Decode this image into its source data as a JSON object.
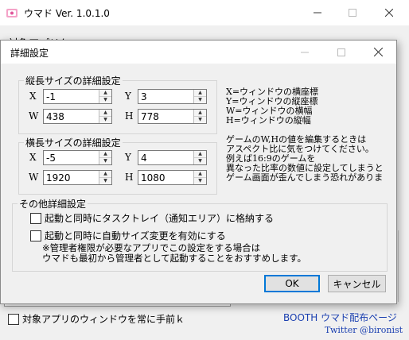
{
  "main_window": {
    "title": "ウマド Ver. 1.0.1.0",
    "partial_label": "対象アプリケ",
    "topmost_checkbox_label": "対象アプリのウィンドウを常に手前ｋ",
    "topmost_checked": false,
    "booth_link": "BOOTH ウマド配布ページ",
    "twitter": "Twitter @bironist"
  },
  "dialog": {
    "title": "詳細設定",
    "portrait": {
      "title": "縦長サイズの詳細設定",
      "x_label": "X",
      "x_value": "-1",
      "y_label": "Y",
      "y_value": "3",
      "w_label": "W",
      "w_value": "438",
      "h_label": "H",
      "h_value": "778"
    },
    "landscape": {
      "title": "横長サイズの詳細設定",
      "x_label": "X",
      "x_value": "-5",
      "y_label": "Y",
      "y_value": "4",
      "w_label": "W",
      "w_value": "1920",
      "h_label": "H",
      "h_value": "1080"
    },
    "legend": {
      "line1": "X=ウィンドウの横座標",
      "line2": "Y=ウィンドウの縦座標",
      "line3": "W=ウィンドウの横幅",
      "line4": "H=ウィンドウの縦幅"
    },
    "warning": {
      "line1": "ゲームのW,Hの値を編集するときは",
      "line2": "アスペクト比に気をつけてください。",
      "line3": "例えば16:9のゲームを",
      "line4": "異なった比率の数値に設定してしまうと",
      "line5": "ゲーム画面が歪んでしまう恐れがありま"
    },
    "other": {
      "title": "その他詳細設定",
      "option1": "起動と同時にタスクトレイ（通知エリア）に格納する",
      "option1_checked": false,
      "option2": "起動と同時に自動サイズ変更を有効にする",
      "option2_checked": false,
      "note1": "※管理者権限が必要なアプリでこの設定をする場合は",
      "note2": "ウマドも最初から管理者として起動することをおすすめします。"
    },
    "ok_label": "OK",
    "cancel_label": "キャンセル"
  },
  "icons": {
    "app_icon": "umado-app-icon",
    "minimize": "minimize-icon",
    "maximize": "maximize-icon",
    "close": "close-icon"
  }
}
